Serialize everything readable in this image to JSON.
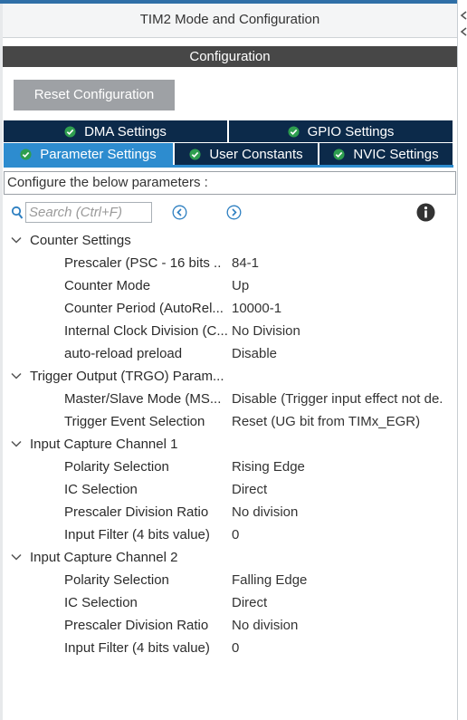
{
  "window": {
    "title": "TIM2 Mode and Configuration"
  },
  "configuration": {
    "header": "Configuration",
    "reset_label": "Reset Configuration"
  },
  "tabs": [
    {
      "label": "DMA Settings"
    },
    {
      "label": "GPIO Settings"
    },
    {
      "label": "Parameter Settings",
      "active": true
    },
    {
      "label": "User Constants"
    },
    {
      "label": "NVIC Settings"
    }
  ],
  "description": "Configure the below parameters :",
  "search": {
    "placeholder": "Search (Ctrl+F)"
  },
  "groups": [
    {
      "label": "Counter Settings",
      "params": [
        {
          "name": "Prescaler (PSC - 16 bits ..",
          "value": "84-1"
        },
        {
          "name": "Counter Mode",
          "value": "Up"
        },
        {
          "name": "Counter Period (AutoRel...",
          "value": "10000-1"
        },
        {
          "name": "Internal Clock Division (C...",
          "value": "No Division"
        },
        {
          "name": "auto-reload preload",
          "value": "Disable"
        }
      ]
    },
    {
      "label": "Trigger Output (TRGO) Param...",
      "params": [
        {
          "name": "Master/Slave Mode (MS...",
          "value": "Disable (Trigger input effect not de."
        },
        {
          "name": "Trigger Event Selection",
          "value": "Reset (UG bit from TIMx_EGR)"
        }
      ]
    },
    {
      "label": "Input Capture Channel 1",
      "params": [
        {
          "name": "Polarity Selection",
          "value": "Rising Edge"
        },
        {
          "name": "IC Selection",
          "value": "Direct"
        },
        {
          "name": "Prescaler Division Ratio",
          "value": "No division"
        },
        {
          "name": "Input Filter (4 bits value)",
          "value": "0"
        }
      ]
    },
    {
      "label": "Input Capture Channel 2",
      "params": [
        {
          "name": "Polarity Selection",
          "value": "Falling Edge"
        },
        {
          "name": "IC Selection",
          "value": "Direct"
        },
        {
          "name": "Prescaler Division Ratio",
          "value": "No division"
        },
        {
          "name": "Input Filter (4 bits value)",
          "value": "0"
        }
      ]
    }
  ],
  "colors": {
    "tab_dark": "#0c2a4a",
    "tab_active": "#2d8ccf",
    "header_bg": "#474747",
    "reset_bg": "#9ea1a5",
    "check_green": "#2e9e4f"
  }
}
